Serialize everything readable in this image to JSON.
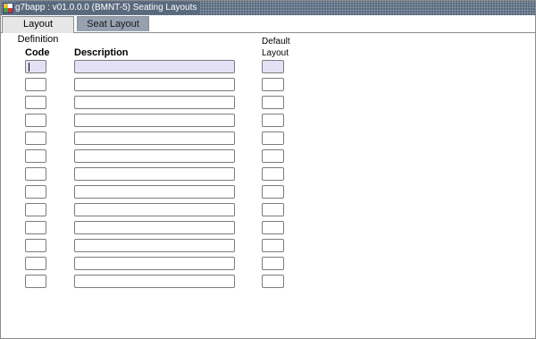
{
  "window": {
    "title": "g7bapp : v01.0.0.0 (BMNT-5) Seating Layouts"
  },
  "tabs": [
    {
      "label": "Layout Definition",
      "active": true
    },
    {
      "label": "Seat Layout",
      "active": false
    }
  ],
  "columns": {
    "code": "Code",
    "description": "Description",
    "default_line1": "Default",
    "default_line2": "Layout"
  },
  "rows": [
    {
      "code": "",
      "description": "",
      "default_layout": ""
    },
    {
      "code": "",
      "description": "",
      "default_layout": ""
    },
    {
      "code": "",
      "description": "",
      "default_layout": ""
    },
    {
      "code": "",
      "description": "",
      "default_layout": ""
    },
    {
      "code": "",
      "description": "",
      "default_layout": ""
    },
    {
      "code": "",
      "description": "",
      "default_layout": ""
    },
    {
      "code": "",
      "description": "",
      "default_layout": ""
    },
    {
      "code": "",
      "description": "",
      "default_layout": ""
    },
    {
      "code": "",
      "description": "",
      "default_layout": ""
    },
    {
      "code": "",
      "description": "",
      "default_layout": ""
    },
    {
      "code": "",
      "description": "",
      "default_layout": ""
    },
    {
      "code": "",
      "description": "",
      "default_layout": ""
    },
    {
      "code": "",
      "description": "",
      "default_layout": ""
    }
  ],
  "colors": {
    "titlebar": "#5a6a7e",
    "active_field": "#e4e1f7",
    "inactive_tab": "#95a1b0"
  }
}
